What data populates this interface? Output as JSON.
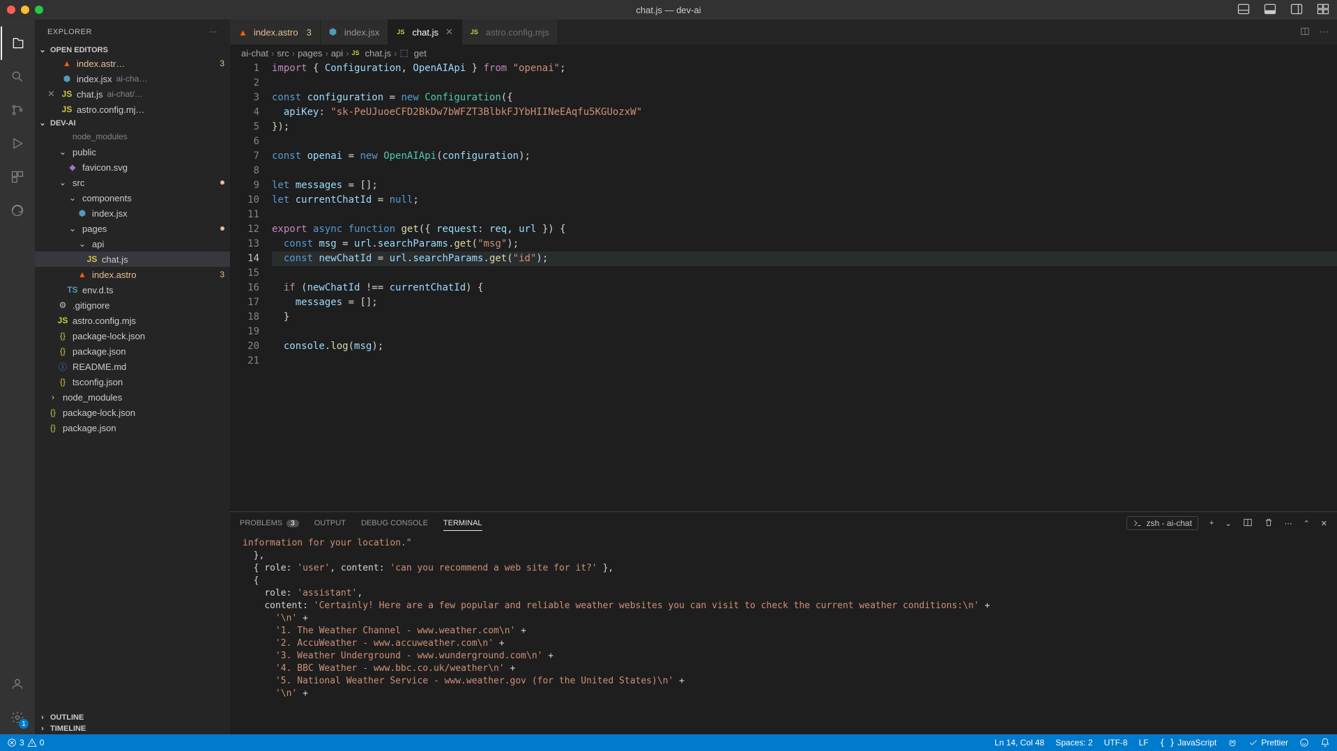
{
  "title": "chat.js — dev-ai",
  "explorer_label": "EXPLORER",
  "sections": {
    "open_editors": "OPEN EDITORS",
    "dev_ai": "DEV-AI",
    "outline": "OUTLINE",
    "timeline": "TIMELINE"
  },
  "open_editors": [
    {
      "name": "index.astr…",
      "sublabel": "",
      "badge": "3",
      "icon": "astro"
    },
    {
      "name": "index.jsx",
      "sublabel": "ai-cha…",
      "icon": "jsx"
    },
    {
      "name": "chat.js",
      "sublabel": "ai-chat/…",
      "icon": "js",
      "close": true
    },
    {
      "name": "astro.config.mj…",
      "sublabel": "",
      "icon": "js"
    }
  ],
  "tree": [
    {
      "label": "node_modules",
      "indent": 1,
      "chev": "none",
      "dim": true
    },
    {
      "label": "public",
      "indent": 1,
      "chev": "down"
    },
    {
      "label": "favicon.svg",
      "indent": 2,
      "icon": "svg"
    },
    {
      "label": "src",
      "indent": 1,
      "chev": "down",
      "dot": "#e2c08d"
    },
    {
      "label": "components",
      "indent": 2,
      "chev": "down"
    },
    {
      "label": "index.jsx",
      "indent": 3,
      "icon": "jsx"
    },
    {
      "label": "pages",
      "indent": 2,
      "chev": "down",
      "dot": "#e2c08d"
    },
    {
      "label": "api",
      "indent": 3,
      "chev": "down"
    },
    {
      "label": "chat.js",
      "indent": 4,
      "icon": "js",
      "selected": true
    },
    {
      "label": "index.astro",
      "indent": 3,
      "icon": "astro",
      "warn": true,
      "badge": "3"
    },
    {
      "label": "env.d.ts",
      "indent": 2,
      "icon": "ts"
    },
    {
      "label": ".gitignore",
      "indent": 1,
      "icon": "gear"
    },
    {
      "label": "astro.config.mjs",
      "indent": 1,
      "icon": "js"
    },
    {
      "label": "package-lock.json",
      "indent": 1,
      "icon": "json"
    },
    {
      "label": "package.json",
      "indent": 1,
      "icon": "json"
    },
    {
      "label": "README.md",
      "indent": 1,
      "icon": "info"
    },
    {
      "label": "tsconfig.json",
      "indent": 1,
      "icon": "json"
    },
    {
      "label": "node_modules",
      "indent": 0,
      "chev": "right"
    },
    {
      "label": "package-lock.json",
      "indent": 0,
      "icon": "json"
    },
    {
      "label": "package.json",
      "indent": 0,
      "icon": "json"
    }
  ],
  "tabs": [
    {
      "name": "index.astro",
      "icon": "astro",
      "badge": "3",
      "warn": true
    },
    {
      "name": "index.jsx",
      "icon": "jsx"
    },
    {
      "name": "chat.js",
      "icon": "js",
      "active": true,
      "close": true
    },
    {
      "name": "astro.config.mjs",
      "icon": "js",
      "dim": true
    }
  ],
  "breadcrumbs": [
    "ai-chat",
    "src",
    "pages",
    "api",
    "chat.js",
    "get"
  ],
  "code": {
    "lines": [
      [
        [
          "kw",
          "import"
        ],
        [
          "punc",
          " { "
        ],
        [
          "var",
          "Configuration"
        ],
        [
          "punc",
          ", "
        ],
        [
          "var",
          "OpenAIApi"
        ],
        [
          "punc",
          " } "
        ],
        [
          "kw",
          "from"
        ],
        [
          "punc",
          " "
        ],
        [
          "str",
          "\"openai\""
        ],
        [
          "punc",
          ";"
        ]
      ],
      [],
      [
        [
          "kw2",
          "const"
        ],
        [
          "punc",
          " "
        ],
        [
          "var",
          "configuration"
        ],
        [
          "punc",
          " = "
        ],
        [
          "kw2",
          "new"
        ],
        [
          "punc",
          " "
        ],
        [
          "type",
          "Configuration"
        ],
        [
          "punc",
          "({"
        ]
      ],
      [
        [
          "punc",
          "  "
        ],
        [
          "var",
          "apiKey"
        ],
        [
          "punc",
          ": "
        ],
        [
          "str",
          "\"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\""
        ]
      ],
      [
        [
          "punc",
          "});"
        ]
      ],
      [],
      [
        [
          "kw2",
          "const"
        ],
        [
          "punc",
          " "
        ],
        [
          "var",
          "openai"
        ],
        [
          "punc",
          " = "
        ],
        [
          "kw2",
          "new"
        ],
        [
          "punc",
          " "
        ],
        [
          "type",
          "OpenAIApi"
        ],
        [
          "punc",
          "("
        ],
        [
          "var",
          "configuration"
        ],
        [
          "punc",
          ");"
        ]
      ],
      [],
      [
        [
          "kw2",
          "let"
        ],
        [
          "punc",
          " "
        ],
        [
          "var",
          "messages"
        ],
        [
          "punc",
          " = [];"
        ]
      ],
      [
        [
          "kw2",
          "let"
        ],
        [
          "punc",
          " "
        ],
        [
          "var",
          "currentChatId"
        ],
        [
          "punc",
          " = "
        ],
        [
          "const",
          "null"
        ],
        [
          "punc",
          ";"
        ]
      ],
      [],
      [
        [
          "kw",
          "export"
        ],
        [
          "punc",
          " "
        ],
        [
          "kw2",
          "async"
        ],
        [
          "punc",
          " "
        ],
        [
          "kw2",
          "function"
        ],
        [
          "punc",
          " "
        ],
        [
          "fn",
          "get"
        ],
        [
          "punc",
          "({ "
        ],
        [
          "var",
          "request"
        ],
        [
          "punc",
          ": "
        ],
        [
          "param",
          "req"
        ],
        [
          "punc",
          ", "
        ],
        [
          "param",
          "url"
        ],
        [
          "punc",
          " }) {"
        ]
      ],
      [
        [
          "punc",
          "  "
        ],
        [
          "kw2",
          "const"
        ],
        [
          "punc",
          " "
        ],
        [
          "var",
          "msg"
        ],
        [
          "punc",
          " = "
        ],
        [
          "var",
          "url"
        ],
        [
          "punc",
          "."
        ],
        [
          "var",
          "searchParams"
        ],
        [
          "punc",
          "."
        ],
        [
          "fn",
          "get"
        ],
        [
          "punc",
          "("
        ],
        [
          "str",
          "\"msg\""
        ],
        [
          "punc",
          ");"
        ]
      ],
      [
        [
          "punc",
          "  "
        ],
        [
          "kw2",
          "const"
        ],
        [
          "punc",
          " "
        ],
        [
          "var",
          "newChatId"
        ],
        [
          "punc",
          " = "
        ],
        [
          "var",
          "url"
        ],
        [
          "punc",
          "."
        ],
        [
          "var",
          "searchParams"
        ],
        [
          "punc",
          "."
        ],
        [
          "fn",
          "get"
        ],
        [
          "punc",
          "("
        ],
        [
          "str",
          "\"id\""
        ],
        [
          "punc",
          ");"
        ]
      ],
      [],
      [
        [
          "punc",
          "  "
        ],
        [
          "kw",
          "if"
        ],
        [
          "punc",
          " ("
        ],
        [
          "var",
          "newChatId"
        ],
        [
          "punc",
          " !== "
        ],
        [
          "var",
          "currentChatId"
        ],
        [
          "punc",
          ") {"
        ]
      ],
      [
        [
          "punc",
          "    "
        ],
        [
          "var",
          "messages"
        ],
        [
          "punc",
          " = [];"
        ]
      ],
      [
        [
          "punc",
          "  }"
        ]
      ],
      [],
      [
        [
          "punc",
          "  "
        ],
        [
          "var",
          "console"
        ],
        [
          "punc",
          "."
        ],
        [
          "fn",
          "log"
        ],
        [
          "punc",
          "("
        ],
        [
          "var",
          "msg"
        ],
        [
          "punc",
          ");"
        ]
      ],
      []
    ],
    "active_line": 14,
    "cursor_col": 48
  },
  "panel": {
    "tabs": {
      "problems": "PROBLEMS",
      "problems_badge": "3",
      "output": "OUTPUT",
      "debug": "DEBUG CONSOLE",
      "terminal": "TERMINAL"
    },
    "dropdown": "zsh - ai-chat"
  },
  "terminal_lines": [
    {
      "pre": "",
      "str": "information for your location.\"",
      "post": ""
    },
    {
      "pre": "  },",
      "str": "",
      "post": ""
    },
    {
      "pre": "  { role: ",
      "str": "'user'",
      "mid": ", content: ",
      "str2": "'can you recommend a web site for it?'",
      "post": " },"
    },
    {
      "pre": "  {",
      "str": "",
      "post": ""
    },
    {
      "pre": "    role: ",
      "str": "'assistant'",
      "post": ","
    },
    {
      "pre": "    content: ",
      "str": "'Certainly! Here are a few popular and reliable weather websites you can visit to check the current weather conditions:\\n'",
      "post": " +"
    },
    {
      "pre": "      ",
      "str": "'\\n'",
      "post": " +"
    },
    {
      "pre": "      ",
      "str": "'1. The Weather Channel - www.weather.com\\n'",
      "post": " +"
    },
    {
      "pre": "      ",
      "str": "'2. AccuWeather - www.accuweather.com\\n'",
      "post": " +"
    },
    {
      "pre": "      ",
      "str": "'3. Weather Underground - www.wunderground.com\\n'",
      "post": " +"
    },
    {
      "pre": "      ",
      "str": "'4. BBC Weather - www.bbc.co.uk/weather\\n'",
      "post": " +"
    },
    {
      "pre": "      ",
      "str": "'5. National Weather Service - www.weather.gov (for the United States)\\n'",
      "post": " +"
    },
    {
      "pre": "      ",
      "str": "'\\n'",
      "post": " +"
    }
  ],
  "status": {
    "errors": "3",
    "warnings": "0",
    "ln_col": "Ln 14, Col 48",
    "spaces": "Spaces: 2",
    "encoding": "UTF-8",
    "eol": "LF",
    "language": "JavaScript",
    "prettier": "Prettier"
  },
  "settings_badge": "1"
}
